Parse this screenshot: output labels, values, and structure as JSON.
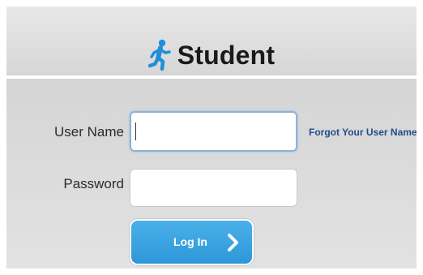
{
  "header": {
    "title": "Student",
    "icon": "runner-icon",
    "icon_color": "#1e8fd8"
  },
  "form": {
    "username_label": "User Name",
    "username_value": "",
    "password_label": "Password",
    "password_value": "",
    "forgot_link": "Forgot Your User Name?",
    "login_button_label": "Log In",
    "login_icon": "chevron-right-icon"
  },
  "colors": {
    "button": "#3aa6e3",
    "link": "#1f4e8c",
    "focus_border": "#8fb1d4"
  }
}
